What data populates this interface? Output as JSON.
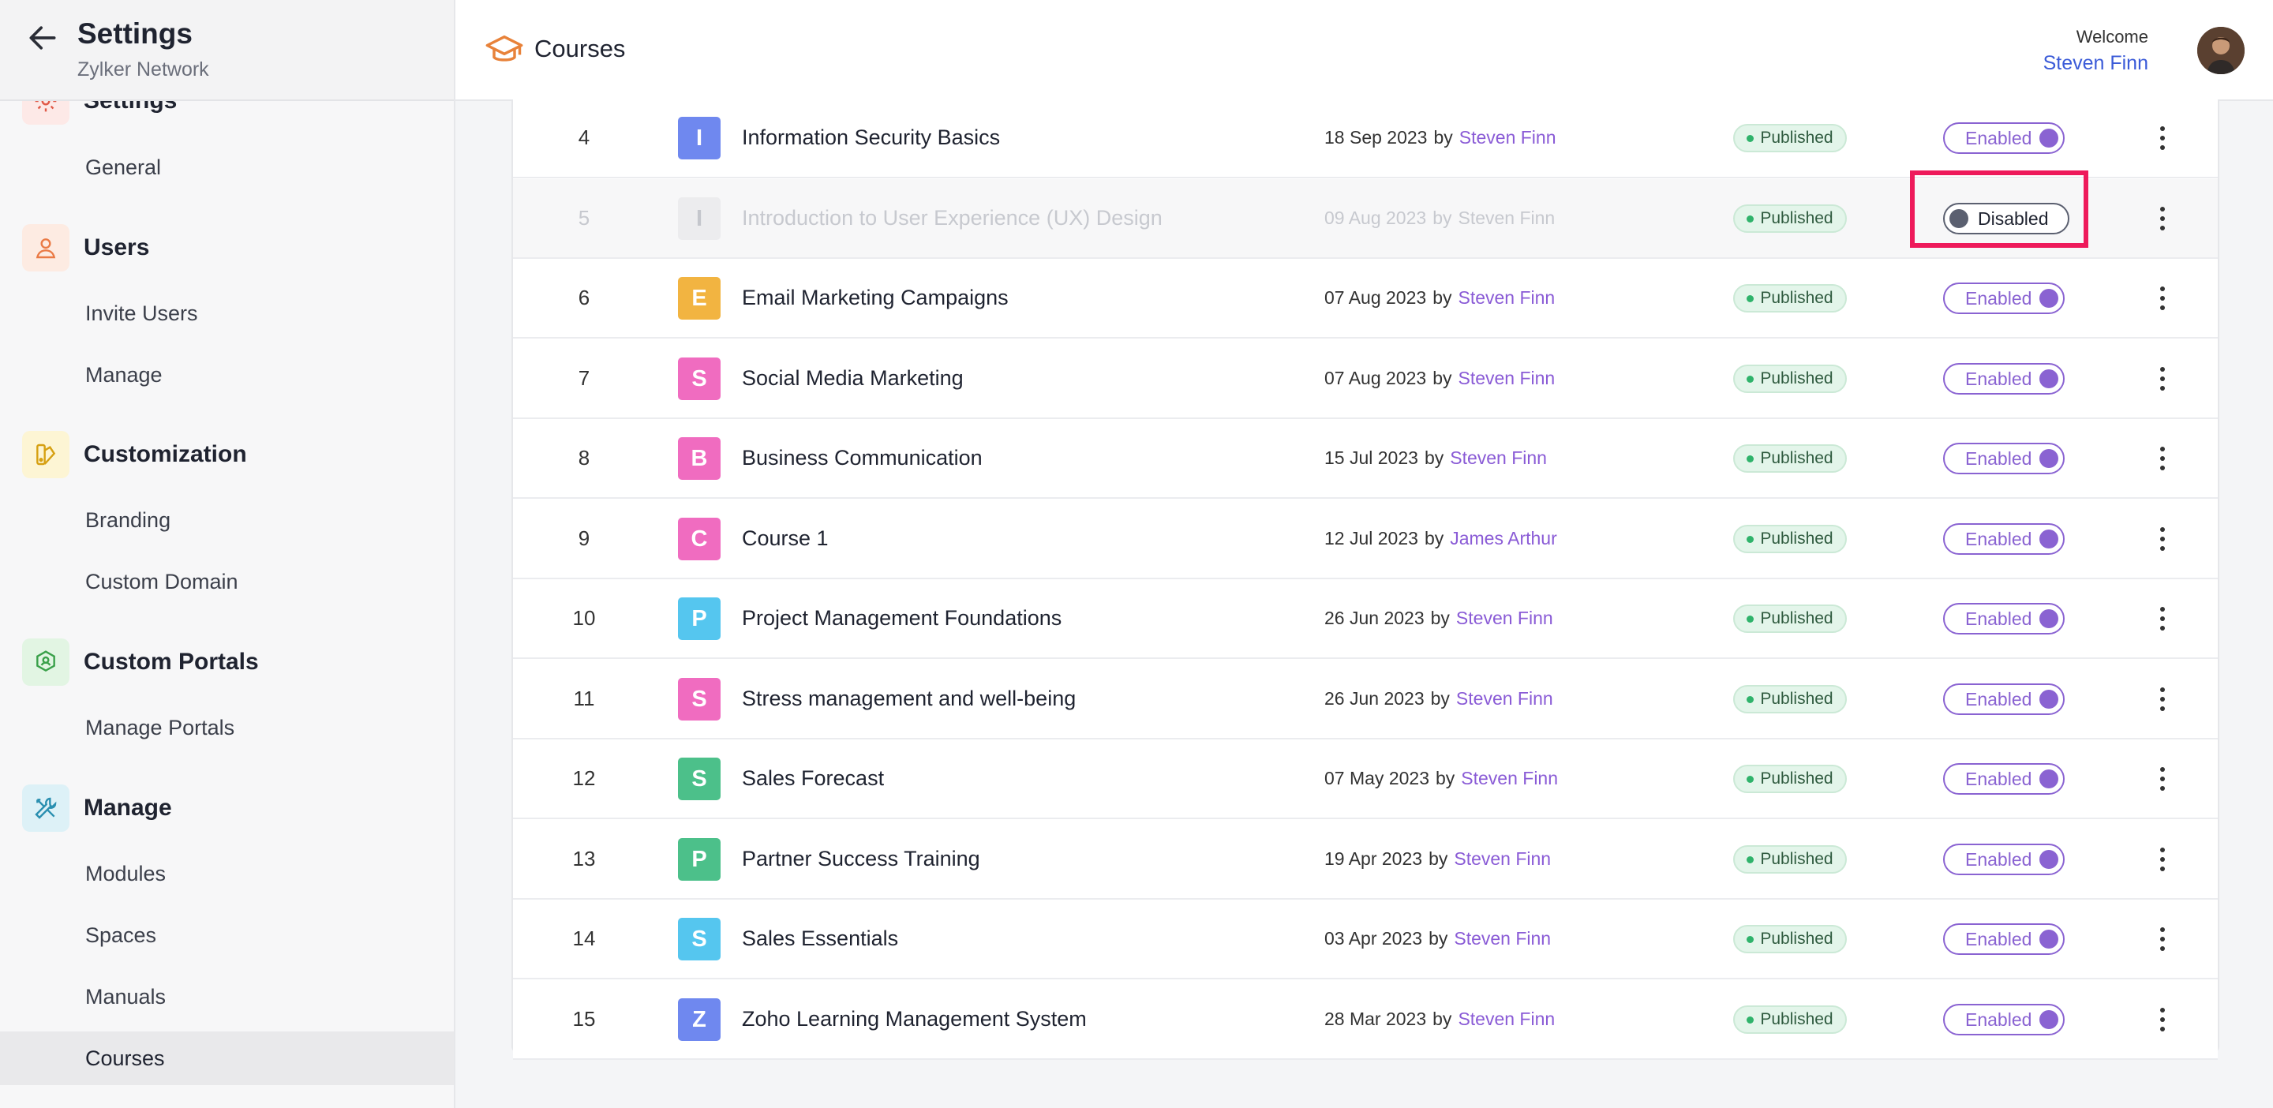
{
  "sidebar": {
    "title": "Settings",
    "subtitle": "Zylker Network",
    "partial_group": "Settings",
    "groups": [
      {
        "label": "Users",
        "icon": "user-icon"
      },
      {
        "label": "Customization",
        "icon": "brush-icon"
      },
      {
        "label": "Custom Portals",
        "icon": "portal-icon"
      },
      {
        "label": "Manage",
        "icon": "tools-icon"
      }
    ],
    "items": {
      "general": "General",
      "invite_users": "Invite Users",
      "manage": "Manage",
      "branding": "Branding",
      "custom_domain": "Custom Domain",
      "manage_portals": "Manage Portals",
      "modules": "Modules",
      "spaces": "Spaces",
      "manuals": "Manuals",
      "courses": "Courses"
    }
  },
  "topbar": {
    "title": "Courses",
    "welcome": "Welcome",
    "username": "Steven Finn"
  },
  "colors": {
    "accent": "#8a63d2",
    "link": "#3b5bd8",
    "published_dot": "#2fb36b",
    "highlight": "#ee1a5b"
  },
  "labels": {
    "by": "by",
    "published": "Published",
    "enabled": "Enabled",
    "disabled": "Disabled"
  },
  "courses": [
    {
      "num": "4",
      "letter": "I",
      "color": "#6f88ef",
      "name": "Information Security Basics",
      "date": "18 Sep 2023",
      "author": "Steven Finn",
      "state": "Enabled"
    },
    {
      "num": "5",
      "letter": "I",
      "color": "#ececee",
      "name": "Introduction to User Experience (UX) Design",
      "date": "09 Aug 2023",
      "author": "Steven Finn",
      "state": "Disabled"
    },
    {
      "num": "6",
      "letter": "E",
      "color": "#f2b441",
      "name": "Email Marketing Campaigns",
      "date": "07 Aug 2023",
      "author": "Steven Finn",
      "state": "Enabled"
    },
    {
      "num": "7",
      "letter": "S",
      "color": "#f06cc0",
      "name": "Social Media Marketing",
      "date": "07 Aug 2023",
      "author": "Steven Finn",
      "state": "Enabled"
    },
    {
      "num": "8",
      "letter": "B",
      "color": "#f06cc0",
      "name": "Business Communication",
      "date": "15 Jul 2023",
      "author": "Steven Finn",
      "state": "Enabled"
    },
    {
      "num": "9",
      "letter": "C",
      "color": "#f06cc0",
      "name": "Course 1",
      "date": "12 Jul 2023",
      "author": "James Arthur",
      "state": "Enabled"
    },
    {
      "num": "10",
      "letter": "P",
      "color": "#55c6ef",
      "name": "Project Management Foundations",
      "date": "26 Jun 2023",
      "author": "Steven Finn",
      "state": "Enabled"
    },
    {
      "num": "11",
      "letter": "S",
      "color": "#f06cc0",
      "name": "Stress management and well-being",
      "date": "26 Jun 2023",
      "author": "Steven Finn",
      "state": "Enabled"
    },
    {
      "num": "12",
      "letter": "S",
      "color": "#4cc08a",
      "name": "Sales Forecast",
      "date": "07 May 2023",
      "author": "Steven Finn",
      "state": "Enabled"
    },
    {
      "num": "13",
      "letter": "P",
      "color": "#4cc08a",
      "name": "Partner Success Training",
      "date": "19 Apr 2023",
      "author": "Steven Finn",
      "state": "Enabled"
    },
    {
      "num": "14",
      "letter": "S",
      "color": "#55c6ef",
      "name": "Sales Essentials",
      "date": "03 Apr 2023",
      "author": "Steven Finn",
      "state": "Enabled"
    },
    {
      "num": "15",
      "letter": "Z",
      "color": "#6f88ef",
      "name": "Zoho Learning Management System",
      "date": "28 Mar 2023",
      "author": "Steven Finn",
      "state": "Enabled"
    }
  ]
}
